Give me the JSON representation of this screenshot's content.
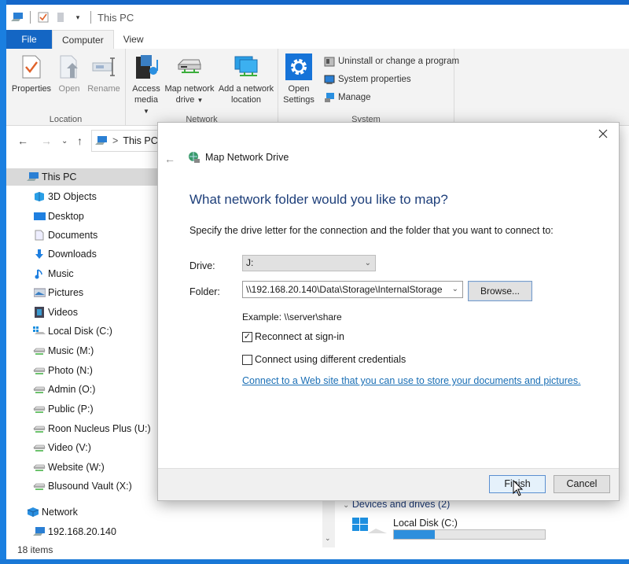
{
  "window": {
    "title": "This PC",
    "quick_access_icons": [
      "computer-icon",
      "properties-check-icon",
      "new-folder-icon",
      "dropdown-arrow-icon"
    ]
  },
  "ribbon": {
    "tabs": [
      {
        "label": "File",
        "active": false
      },
      {
        "label": "Computer",
        "active": true
      },
      {
        "label": "View",
        "active": false
      }
    ],
    "groups": {
      "location": {
        "label": "Location",
        "buttons": [
          {
            "label": "Properties",
            "icon": "properties-icon",
            "enabled": true
          },
          {
            "label": "Open",
            "icon": "open-icon",
            "enabled": false
          },
          {
            "label": "Rename",
            "icon": "rename-icon",
            "enabled": false
          }
        ]
      },
      "network": {
        "label": "Network",
        "buttons": [
          {
            "label_line1": "Access",
            "label_line2": "media",
            "icon": "access-media-icon",
            "has_dropdown": true
          },
          {
            "label_line1": "Map network",
            "label_line2": "drive",
            "icon": "map-network-drive-icon",
            "has_dropdown": true
          },
          {
            "label_line1": "Add a network",
            "label_line2": "location",
            "icon": "add-network-location-icon",
            "has_dropdown": false
          }
        ]
      },
      "system": {
        "label": "System",
        "open_settings_line1": "Open",
        "open_settings_line2": "Settings",
        "small_buttons": [
          {
            "label": "Uninstall or change a program",
            "icon": "uninstall-icon"
          },
          {
            "label": "System properties",
            "icon": "system-properties-icon"
          },
          {
            "label": "Manage",
            "icon": "manage-icon"
          }
        ]
      }
    }
  },
  "navigation": {
    "address_path": "This PC",
    "separator": ">"
  },
  "nav_pane": {
    "items": [
      {
        "label": "This PC",
        "icon": "this-pc-icon",
        "level": 0,
        "selected": true
      },
      {
        "label": "3D Objects",
        "icon": "3d-objects-icon",
        "level": 1
      },
      {
        "label": "Desktop",
        "icon": "desktop-icon",
        "level": 1
      },
      {
        "label": "Documents",
        "icon": "documents-icon",
        "level": 1
      },
      {
        "label": "Downloads",
        "icon": "downloads-icon",
        "level": 1
      },
      {
        "label": "Music",
        "icon": "music-icon",
        "level": 1
      },
      {
        "label": "Pictures",
        "icon": "pictures-icon",
        "level": 1
      },
      {
        "label": "Videos",
        "icon": "videos-icon",
        "level": 1
      },
      {
        "label": "Local Disk (C:)",
        "icon": "local-disk-icon",
        "level": 1
      },
      {
        "label": "Music (M:)",
        "icon": "network-drive-icon",
        "level": 1
      },
      {
        "label": "Photo (N:)",
        "icon": "network-drive-icon",
        "level": 1
      },
      {
        "label": "Admin (O:)",
        "icon": "network-drive-icon",
        "level": 1
      },
      {
        "label": "Public (P:)",
        "icon": "network-drive-icon",
        "level": 1
      },
      {
        "label": "Roon Nucleus Plus (U:)",
        "icon": "network-drive-icon",
        "level": 1
      },
      {
        "label": "Video (V:)",
        "icon": "network-drive-icon",
        "level": 1
      },
      {
        "label": "Website (W:)",
        "icon": "network-drive-icon",
        "level": 1
      },
      {
        "label": "Blusound Vault (X:)",
        "icon": "network-drive-icon",
        "level": 1
      },
      {
        "label": "Network",
        "icon": "network-icon",
        "level": 0
      },
      {
        "label": "192.168.20.140",
        "icon": "network-computer-icon",
        "level": 1
      }
    ]
  },
  "status_bar": {
    "item_count": "18 items"
  },
  "content": {
    "section_header": "Devices and drives (2)",
    "drive": {
      "name": "Local Disk (C:)",
      "usage_fraction": 0.27
    }
  },
  "dialog": {
    "title": "Map Network Drive",
    "heading": "What network folder would you like to map?",
    "description": "Specify the drive letter for the connection and the folder that you want to connect to:",
    "drive_label": "Drive:",
    "drive_value": "J:",
    "folder_label": "Folder:",
    "folder_value": "\\\\192.168.20.140\\Data\\Storage\\InternalStorage",
    "browse_label": "Browse...",
    "example_text": "Example: \\\\server\\share",
    "reconnect_label": "Reconnect at sign-in",
    "reconnect_checked": true,
    "credentials_label": "Connect using different credentials",
    "credentials_checked": false,
    "web_link": "Connect to a Web site that you can use to store your documents and pictures.",
    "finish_label": "Finish",
    "cancel_label": "Cancel"
  },
  "colors": {
    "accent": "#1466c4",
    "heading_blue": "#1e3f7a",
    "link_blue": "#1a6fb5",
    "drive_bar_fill": "#2d8fdd"
  }
}
